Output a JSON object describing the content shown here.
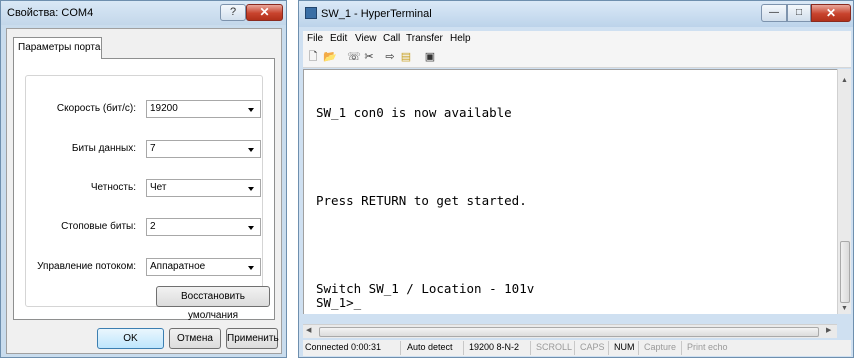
{
  "dialog": {
    "title": "Свойства: COM4",
    "help_btn": "?",
    "close_btn": "✕",
    "tab_label": "Параметры порта",
    "fields": [
      {
        "label": "Скорость (бит/с):",
        "value": "19200"
      },
      {
        "label": "Биты данных:",
        "value": "7"
      },
      {
        "label": "Четность:",
        "value": "Чет"
      },
      {
        "label": "Стоповые биты:",
        "value": "2"
      },
      {
        "label": "Управление потоком:",
        "value": "Аппаратное"
      }
    ],
    "restore_btn": "Восстановить умолчания",
    "ok_btn": "OK",
    "cancel_btn": "Отмена",
    "apply_btn": "Применить"
  },
  "terminal_window": {
    "title": "SW_1 - HyperTerminal",
    "min_btn": "—",
    "max_btn": "□",
    "close_btn": "✕",
    "menu": [
      "File",
      "Edit",
      "View",
      "Call",
      "Transfer",
      "Help"
    ],
    "toolbar_icons": [
      "new-file-icon",
      "open-folder-icon",
      "phone-icon",
      "disconnect-icon",
      "send-icon",
      "receive-icon",
      "properties-icon"
    ],
    "lines": [
      "SW_1 con0 is now available",
      "Press RETURN to get started.",
      "Switch SW_1 / Location - 101v",
      "SW_1>_"
    ],
    "status": {
      "connected": "Connected 0:00:31",
      "detect": "Auto detect",
      "settings": "19200 8-N-2",
      "scroll": "SCROLL",
      "caps": "CAPS",
      "num": "NUM",
      "capture": "Capture",
      "print_echo": "Print echo"
    }
  }
}
